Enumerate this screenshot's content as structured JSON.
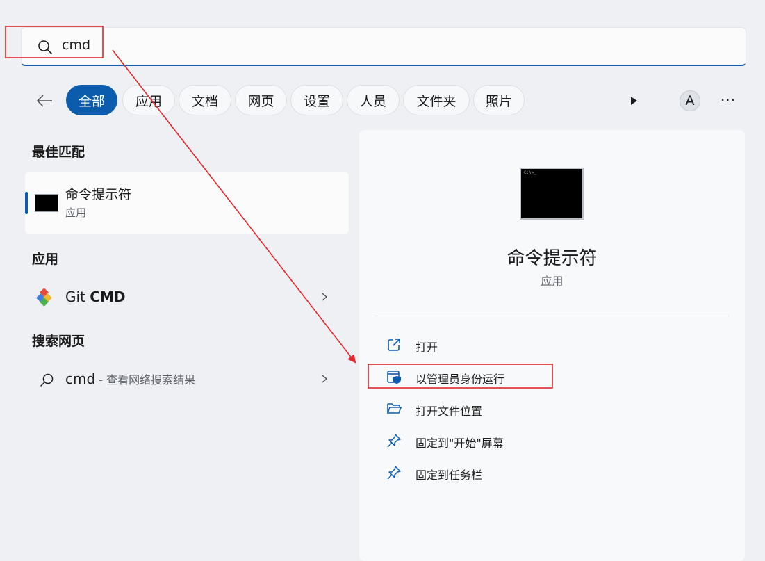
{
  "search": {
    "query": "cmd"
  },
  "filters": [
    {
      "label": "全部",
      "active": true
    },
    {
      "label": "应用"
    },
    {
      "label": "文档"
    },
    {
      "label": "网页"
    },
    {
      "label": "设置"
    },
    {
      "label": "人员"
    },
    {
      "label": "文件夹"
    },
    {
      "label": "照片"
    }
  ],
  "account": {
    "initial": "A"
  },
  "more": {
    "label": "···"
  },
  "sections": {
    "best_match": "最佳匹配",
    "apps": "应用",
    "search_web": "搜索网页"
  },
  "best_match": {
    "name": "命令提示符",
    "type": "应用",
    "icon": "command-prompt-icon"
  },
  "apps": [
    {
      "name_prefix": "Git ",
      "name_bold": "CMD",
      "icon": "git-icon"
    }
  ],
  "web": {
    "query": "cmd",
    "suffix": " - 查看网络搜索结果"
  },
  "detail": {
    "name": "命令提示符",
    "type": "应用",
    "terminal_text": "C:\\>_",
    "actions": [
      {
        "label": "打开",
        "icon": "open-external-icon"
      },
      {
        "label": "以管理员身份运行",
        "icon": "admin-shield-icon"
      },
      {
        "label": "打开文件位置",
        "icon": "folder-icon"
      },
      {
        "label": "固定到\"开始\"屏幕",
        "icon": "pin-icon"
      },
      {
        "label": "固定到任务栏",
        "icon": "pin-icon"
      }
    ]
  },
  "colors": {
    "accent": "#0b5cad",
    "annotation": "#e0262b"
  }
}
